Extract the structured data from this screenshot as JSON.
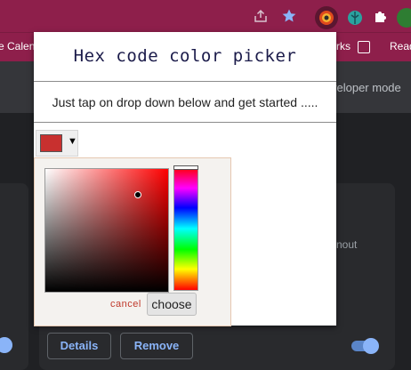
{
  "toolbar": {
    "share_icon": "share-icon",
    "star_icon": "star-icon",
    "puzzle_icon": "puzzle-icon",
    "profile_icon": "profile-icon"
  },
  "bookmarks": {
    "left_item": "e Calend",
    "middle_item": "rks",
    "right_item": "Read"
  },
  "extensions_page": {
    "developer_mode_label": "veloper mode",
    "card_text": "nout",
    "details_label": "Details",
    "remove_label": "Remove"
  },
  "popup": {
    "title": "Hex code color picker",
    "subtitle": "Just tap on drop down below and get started .....",
    "swatch_color": "#c8302f",
    "dropdown_caret": "▼",
    "picker": {
      "hue_color": "#ff0000",
      "cancel_label": "cancel",
      "choose_label": "choose"
    }
  },
  "colors": {
    "browser_frame": "#8e1f4b",
    "page_bg": "#202124",
    "accent": "#8ab4f8",
    "cancel_red": "#c0392b"
  }
}
